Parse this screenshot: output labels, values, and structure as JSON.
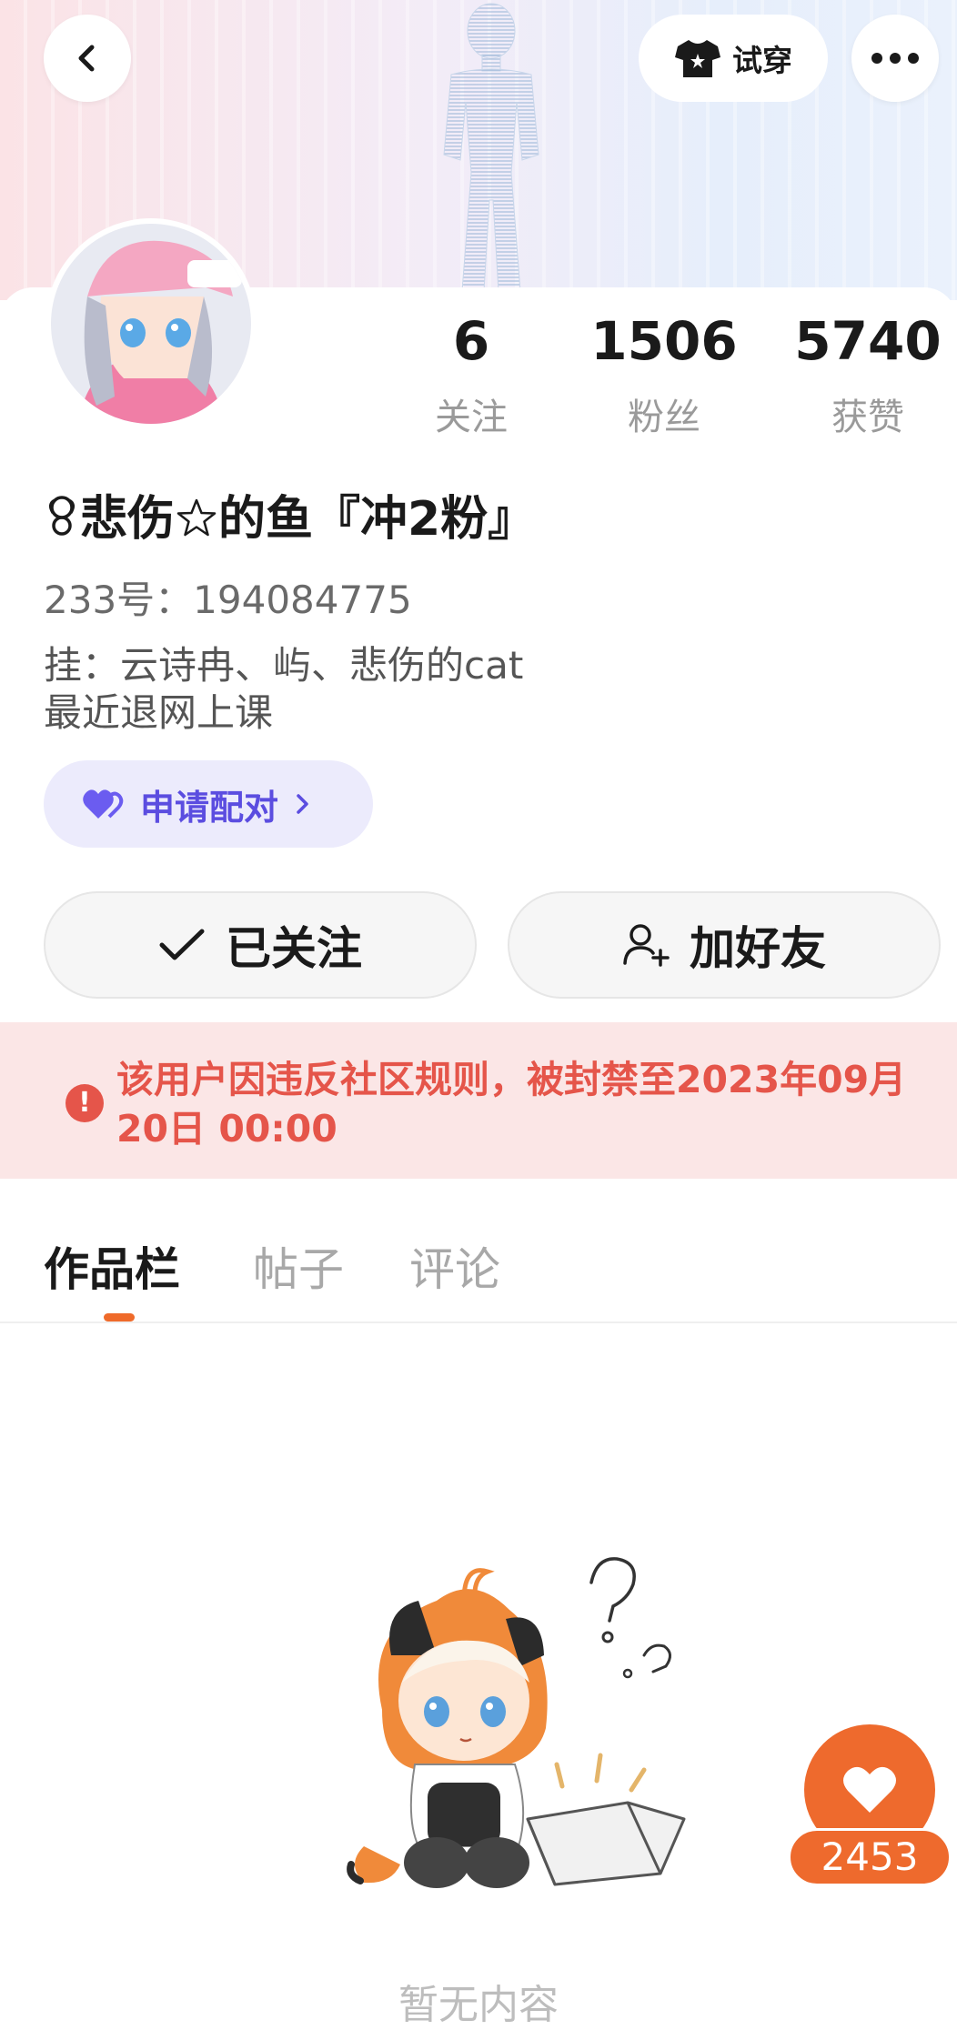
{
  "header": {
    "back_icon": "chevron-left-icon",
    "try_on_label": "试穿",
    "more_icon": "more-horizontal-icon"
  },
  "stats": [
    {
      "value": "6",
      "label": "关注"
    },
    {
      "value": "1506",
      "label": "粉丝"
    },
    {
      "value": "5740",
      "label": "获赞"
    }
  ],
  "profile": {
    "username_prefix": "悲伤",
    "username_suffix": "的鱼『冲2粉』",
    "uid": "233号：194084775",
    "bio_line1": "挂：云诗冉、屿、悲伤的cat",
    "bio_line2": "最近退网上课"
  },
  "actions": {
    "pair_label": "申请配对",
    "followed_label": "已关注",
    "add_friend_label": "加好友"
  },
  "ban_notice": {
    "text": "该用户因违反社区规则，被封禁至2023年09月20日 00:00"
  },
  "tabs": [
    {
      "label": "作品栏",
      "active": true
    },
    {
      "label": "帖子",
      "active": false
    },
    {
      "label": "评论",
      "active": false
    }
  ],
  "empty_state": {
    "text": "暂无内容"
  },
  "like_fab": {
    "count": "2453"
  },
  "colors": {
    "accent": "#ee6a2d",
    "ban_text": "#e5554a",
    "ban_bg": "#fbe6e6",
    "pair_text": "#5b4de0",
    "pair_bg": "#ecebfc"
  }
}
